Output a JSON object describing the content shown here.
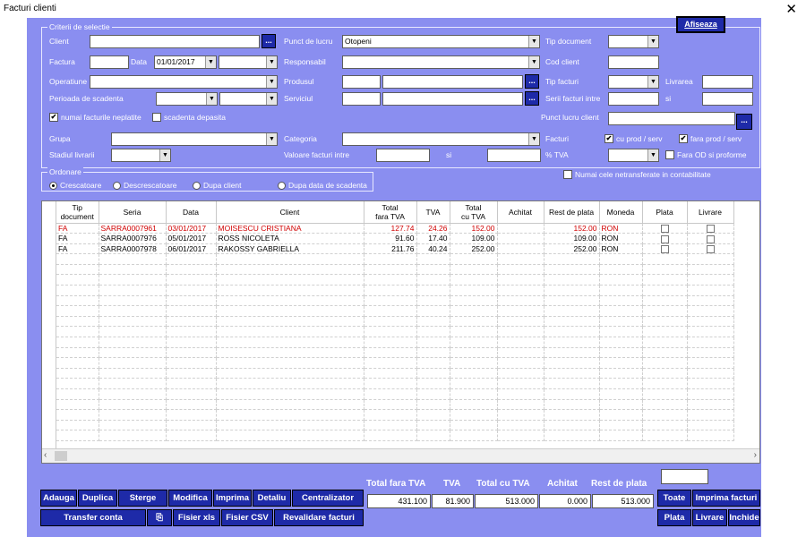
{
  "window": {
    "title": "Facturi clienti",
    "close_glyph": "✕"
  },
  "criteria": {
    "group_title": "Criterii de selectie",
    "client_label": "Client",
    "client_value": "",
    "punct_lucru_label": "Punct de lucru",
    "punct_lucru_value": "Otopeni",
    "tip_document_label": "Tip document",
    "factura_label": "Factura",
    "data_label": "Data",
    "data_value": "01/01/2017",
    "responsabil_label": "Responsabil",
    "cod_client_label": "Cod client",
    "operatiune_label": "Operatiune",
    "produsul_label": "Produsul",
    "tip_facturi_label": "Tip facturi",
    "livrarea_label": "Livrarea",
    "perioada_label": "Perioada de scadenta",
    "serviciul_label": "Serviciul",
    "serii_label": "Serii facturi intre",
    "si_label": "si",
    "numai_neplatite_label": "numai facturile neplatite",
    "scadenta_depasita_label": "scadenta depasita",
    "punct_lucru_client_label": "Punct lucru client",
    "grupa_label": "Grupa",
    "categoria_label": "Categoria",
    "facturi_label": "Facturi",
    "cu_prod_label": "cu prod / serv",
    "fara_prod_label": "fara prod / serv",
    "stadiul_label": "Stadiul livrarii",
    "valoare_label": "Valoare facturi intre",
    "tva_label": "% TVA",
    "fara_od_label": "Fara OD si proforme",
    "dots": "..."
  },
  "afiseaza_button": "Afiseaza",
  "ordonare": {
    "group_title": "Ordonare",
    "options": [
      "Crescatoare",
      "Descrescatoare",
      "Dupa client",
      "Dupa data de scadenta"
    ],
    "selected_index": 0,
    "netransferate_label": "Numai cele netransferate in contabilitate"
  },
  "table": {
    "headers": [
      "Tip\ndocument",
      "Seria",
      "Data",
      "Client",
      "Total\nfara TVA",
      "TVA",
      "Total\ncu TVA",
      "Achitat",
      "Rest de plata",
      "Moneda",
      "Plata",
      "Livrare"
    ],
    "rows": [
      {
        "tip": "FA",
        "seria": "SARRA0007961",
        "data": "03/01/2017",
        "client": "MOISESCU CRISTIANA",
        "total_fara": "127.74",
        "tva": "24.26",
        "total_cu": "152.00",
        "achitat": "",
        "rest": "152.00",
        "moneda": "RON",
        "highlight": true
      },
      {
        "tip": "FA",
        "seria": "SARRA0007976",
        "data": "05/01/2017",
        "client": "ROSS NICOLETA",
        "total_fara": "91.60",
        "tva": "17.40",
        "total_cu": "109.00",
        "achitat": "",
        "rest": "109.00",
        "moneda": "RON",
        "highlight": false
      },
      {
        "tip": "FA",
        "seria": "SARRA0007978",
        "data": "06/01/2017",
        "client": "RAKOSSY GABRIELLA",
        "total_fara": "211.76",
        "tva": "40.24",
        "total_cu": "252.00",
        "achitat": "",
        "rest": "252.00",
        "moneda": "RON",
        "highlight": false
      }
    ]
  },
  "totals": {
    "labels": [
      "Total fara TVA",
      "TVA",
      "Total cu TVA",
      "Achitat",
      "Rest de plata"
    ],
    "values": [
      "431.100",
      "81.900",
      "513.000",
      "0.000",
      "513.000"
    ]
  },
  "buttons": {
    "adauga": "Adauga",
    "duplica": "Duplica",
    "sterge": "Sterge",
    "modifica": "Modifica",
    "imprima": "Imprima",
    "detaliu": "Detaliu",
    "centralizator": "Centralizator",
    "transfer_conta": "Transfer conta",
    "copy_icon": "⎘",
    "fisier_xls": "Fisier xls",
    "fisier_csv": "Fisier CSV",
    "revalidare": "Revalidare facturi",
    "toate": "Toate",
    "imprima_facturi": "Imprima facturi",
    "plata": "Plata",
    "livrare": "Livrare",
    "inchide": "Inchide"
  },
  "colors": {
    "panel": "#8a8ef0",
    "button": "#1e2aa8",
    "highlight_text": "#d00000"
  }
}
